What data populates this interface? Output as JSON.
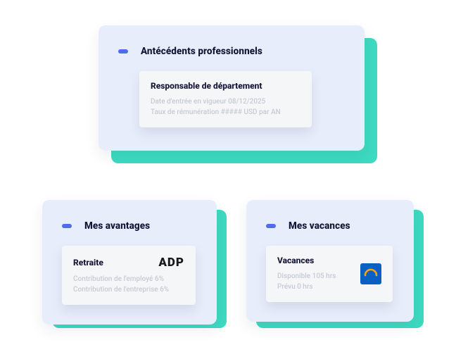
{
  "cards": {
    "history": {
      "title": "Antécédents professionnels",
      "item": {
        "title": "Responsable de département",
        "line1": "Date d'entrée en vigueur 08/12/2025",
        "line2": "Taux de rémunération ##### USD par AN"
      }
    },
    "benefits": {
      "title": "Mes avantages",
      "item": {
        "title": "Retraite",
        "provider": "ADP",
        "line1": "Contribution de l'employé 6%",
        "line2": "Contribution de l'entreprise 6%"
      }
    },
    "vacation": {
      "title": "Mes vacances",
      "item": {
        "title": "Vacances",
        "provider_icon": "workday-icon",
        "line1": "Disponible 105 hrs",
        "line2": "Prévu 0 hrs"
      }
    }
  },
  "colors": {
    "accent": "#4f6bf0",
    "teal": "#3ddac0",
    "card_bg": "#e8edfb"
  }
}
